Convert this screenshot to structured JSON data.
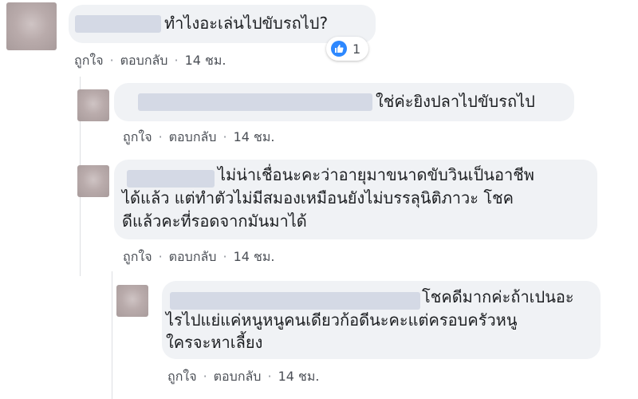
{
  "comments": [
    {
      "text": "ทำไงอะเล่นไปขับรถไป?",
      "like_label": "ถูกใจ",
      "reply_label": "ตอบกลับ",
      "time": "14 ชม.",
      "reaction_count": "1"
    },
    {
      "text": "ใช่ค่ะยิงปลาไปขับรถไป",
      "like_label": "ถูกใจ",
      "reply_label": "ตอบกลับ",
      "time": "14 ชม."
    },
    {
      "lines": [
        "ไม่น่าเชื่อนะคะว่าอายุมาขนาดขับวินเป็นอาชีพ",
        "ได้แล้ว แต่ทำตัวไม่มีสมองเหมือนยังไม่บรรลุนิติภาวะ โชค",
        "ดีแล้วคะที่รอดจากมันมาได้"
      ],
      "like_label": "ถูกใจ",
      "reply_label": "ตอบกลับ",
      "time": "14 ชม."
    },
    {
      "lines": [
        "โชคดีมากค่ะถ้าเปนอะ",
        "ไรไปแย่แค่หนูหนูคนเดียวก้อดีนะคะแต่ครอบครัวหนู",
        "ใครจะหาเลี้ยง"
      ],
      "like_label": "ถูกใจ",
      "reply_label": "ตอบกลับ",
      "time": "14 ชม."
    }
  ],
  "separator": "·",
  "colors": {
    "bubble": "#f0f2f5",
    "link": "#4b4f56",
    "like_blue": "#2d88ff"
  },
  "icons": {
    "reaction": "thumbs-up-icon"
  }
}
